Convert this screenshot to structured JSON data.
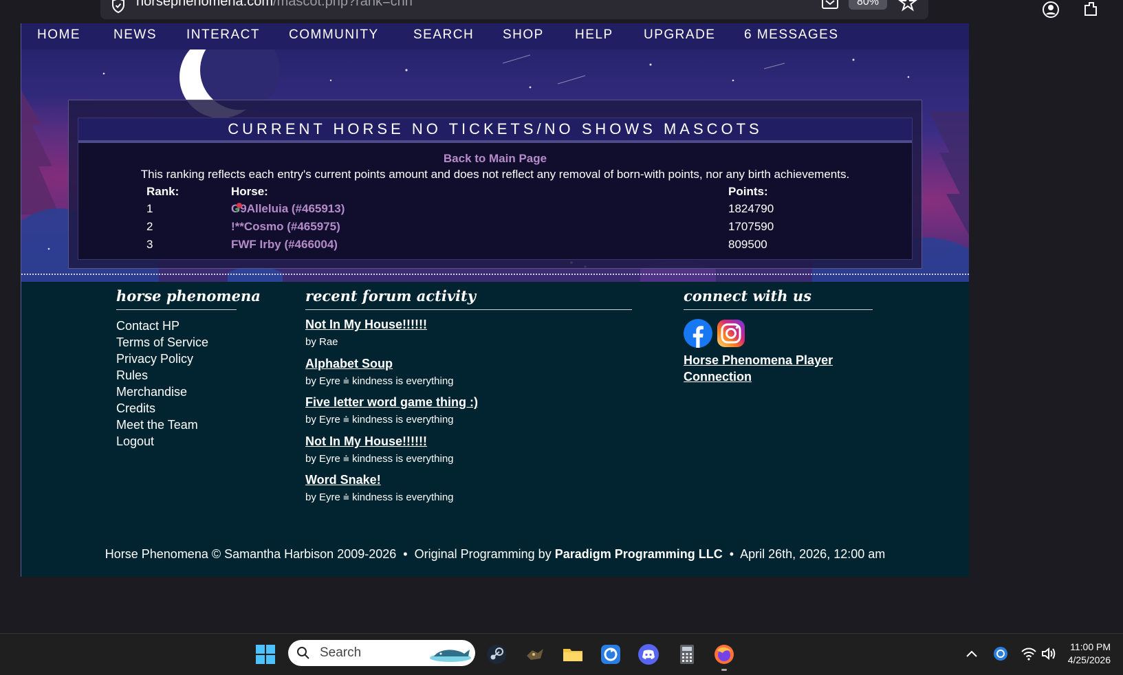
{
  "browser": {
    "url_host": "horsephenomena.com",
    "url_path": "/mascot.php?rank=chn",
    "zoom": "80%"
  },
  "nav": {
    "items": [
      "HOME",
      "NEWS",
      "INTERACT",
      "COMMUNITY",
      "SEARCH",
      "SHOP",
      "HELP",
      "UPGRADE",
      "6 MESSAGES"
    ]
  },
  "ranking": {
    "title": "CURRENT HORSE NO TICKETS/NO SHOWS MASCOTS",
    "back_link": "Back to Main Page",
    "notice": "This ranking reflects each entry's current points amount and does not reflect any removal of born-with points, nor any birth achievements.",
    "headers": {
      "rank": "Rank:",
      "horse": "Horse:",
      "points": "Points:"
    },
    "rows": [
      {
        "rank": "1",
        "horse_prefix": "G9",
        "horse_name": "Alleluia (#465913)",
        "points": "1824790"
      },
      {
        "rank": "2",
        "horse_prefix": "",
        "horse_name": "!**Cosmo (#465975)",
        "points": "1707590"
      },
      {
        "rank": "3",
        "horse_prefix": "",
        "horse_name": "FWF Irby (#466004)",
        "points": "809500"
      }
    ]
  },
  "footer": {
    "col1_heading": "horse phenomena",
    "links": [
      "Contact HP",
      "Terms of Service",
      "Privacy Policy",
      "Rules",
      "Merchandise",
      "Credits",
      "Meet the Team",
      "Logout"
    ],
    "col2_heading": "recent forum activity",
    "forum": [
      {
        "title": "Not In My House!!!!!!",
        "by": "by Rae"
      },
      {
        "title": "Alphabet Soup",
        "by": "by Eyre ⩧ kindness is everything"
      },
      {
        "title": "Five letter word game thing :)",
        "by": "by Eyre ⩧ kindness is everything"
      },
      {
        "title": "Not In My House!!!!!!",
        "by": "by Eyre ⩧ kindness is everything"
      },
      {
        "title": "Word Snake!",
        "by": "by Eyre ⩧ kindness is everything"
      }
    ],
    "col3_heading": "connect with us",
    "player_connection": "Horse Phenomena Player Connection",
    "copyright_a": "Horse Phenomena © Samantha Harbison 2009-2026",
    "copyright_b": "Original Programming by",
    "copyright_company": "Paradigm Programming LLC",
    "copyright_date": "April 26th, 2026, 12:00 am",
    "separator": "•"
  },
  "taskbar": {
    "search_placeholder": "Search",
    "time": "11:00 PM",
    "date": "4/25/2026"
  },
  "colors": {
    "nav_bg": "#211e63",
    "page_bg": "#012430",
    "link_purple": "#b58cc9",
    "panel_bg": "#100e2c"
  }
}
